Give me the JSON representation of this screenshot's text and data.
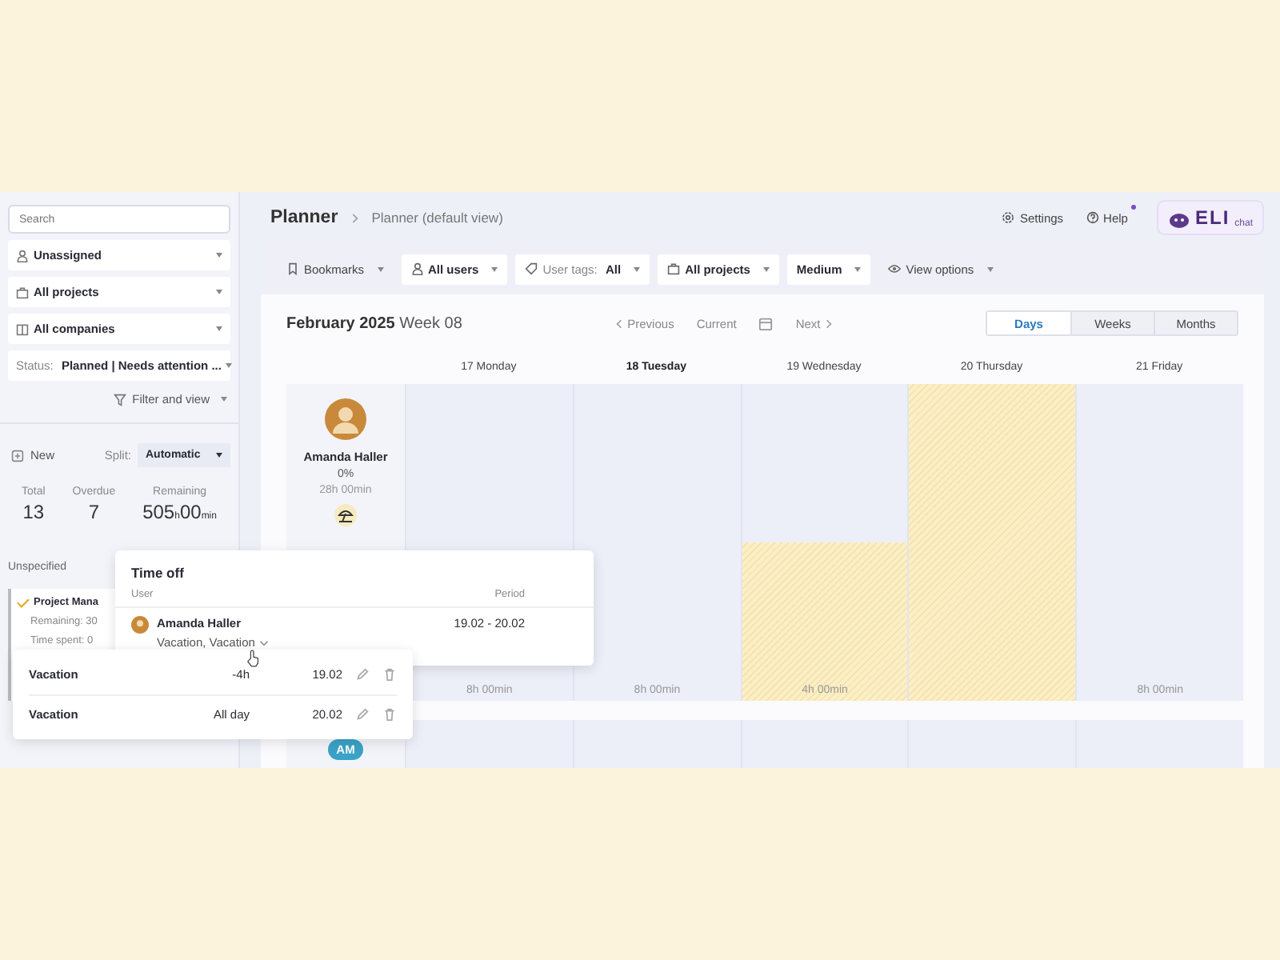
{
  "breadcrumb": {
    "title": "Planner",
    "view": "Planner (default view)"
  },
  "header_links": [
    {
      "label": "Settings",
      "kind": "settings"
    },
    {
      "label": "Help",
      "kind": "help",
      "dot": true
    }
  ],
  "logo": {
    "text": "ELI",
    "sub": "chat"
  },
  "sidebar": {
    "search": {
      "placeholder": "Search"
    },
    "filters": [
      {
        "label": "Unassigned",
        "kind": "user"
      },
      {
        "label": "All projects",
        "kind": "folder"
      },
      {
        "label": "All companies",
        "kind": "building"
      },
      {
        "prefix": "Status:",
        "label": "Planned | Needs attention ...",
        "kind": "status"
      }
    ],
    "filter_button": "Filter and view",
    "new_button": "New",
    "split": {
      "label": "Split:",
      "value": "Automatic"
    },
    "stats": [
      {
        "label": "Total",
        "value": "13"
      },
      {
        "label": "Overdue",
        "value": "7"
      },
      {
        "label": "Remaining",
        "value": "505",
        "unit": "h",
        "value2": "00",
        "unit2": "min"
      }
    ],
    "section": "Unspecified",
    "task": {
      "title": "Project Mana",
      "checked": true,
      "lines": [
        "Remaining: 30",
        "Time spent: 0"
      ]
    }
  },
  "toolbar": [
    {
      "label": "Bookmarks",
      "kind": "bookmark"
    },
    {
      "label": "All users",
      "kind": "user"
    },
    {
      "prefix": "User tags:",
      "label": "All",
      "kind": "tag"
    },
    {
      "label": "All projects",
      "kind": "folder"
    },
    {
      "label": "Medium",
      "kind": "plain"
    },
    {
      "label": "View options",
      "kind": "eye"
    }
  ],
  "period": {
    "month": "February 2025",
    "week": "Week 08"
  },
  "nav": {
    "previous": "Previous",
    "current": "Current",
    "next": "Next"
  },
  "ranges": [
    {
      "label": "Days",
      "selected": true
    },
    {
      "label": "Weeks",
      "selected": false
    },
    {
      "label": "Months",
      "selected": false
    }
  ],
  "days": [
    {
      "label": "17 Monday",
      "today": false,
      "kind": "workday",
      "hours": "8h 00min"
    },
    {
      "label": "18 Tuesday",
      "today": true,
      "kind": "workday",
      "hours": "8h 00min"
    },
    {
      "label": "19 Wednesday",
      "today": false,
      "kind": "halfoff",
      "hours": "4h 00min"
    },
    {
      "label": "20 Thursday",
      "today": false,
      "kind": "dayoff"
    },
    {
      "label": "21 Friday",
      "today": false,
      "kind": "workday",
      "hours": "8h 00min"
    }
  ],
  "users": [
    {
      "name": "Amanda Haller",
      "load": "0%",
      "hours": "28h 00min",
      "on_vacation": true
    },
    {
      "initials": "AM"
    }
  ],
  "time_off_popup": {
    "title": "Time off",
    "columns": [
      "User",
      "Period"
    ],
    "user": "Amanda Haller",
    "types": "Vacation, Vacation",
    "period": "19.02 - 20.02"
  },
  "entries": [
    {
      "type": "Vacation",
      "duration": "-4h",
      "date": "19.02"
    },
    {
      "type": "Vacation",
      "duration": "All day",
      "date": "20.02"
    }
  ]
}
